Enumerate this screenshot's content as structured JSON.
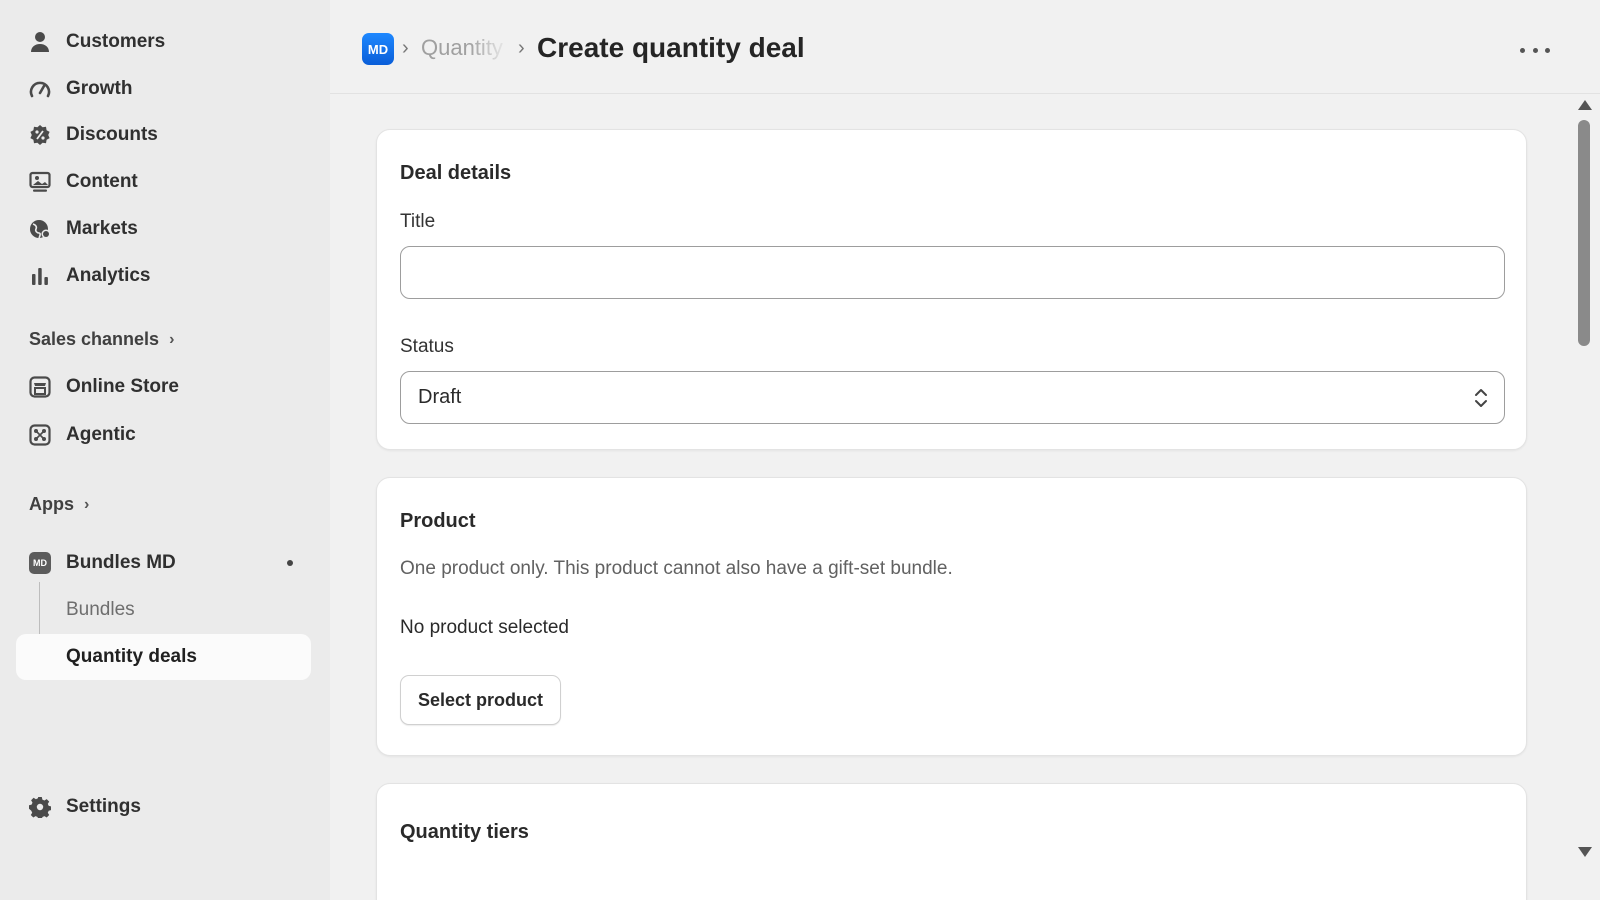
{
  "sidebar": {
    "items": [
      {
        "label": "Customers",
        "icon": "person-icon"
      },
      {
        "label": "Growth",
        "icon": "gauge-icon"
      },
      {
        "label": "Discounts",
        "icon": "discount-badge-icon"
      },
      {
        "label": "Content",
        "icon": "content-icon"
      },
      {
        "label": "Markets",
        "icon": "globe-icon"
      },
      {
        "label": "Analytics",
        "icon": "bar-chart-icon"
      }
    ],
    "sales_channels": {
      "heading": "Sales channels",
      "items": [
        {
          "label": "Online Store",
          "icon": "store-icon"
        },
        {
          "label": "Agentic",
          "icon": "agentic-icon"
        }
      ]
    },
    "apps": {
      "heading": "Apps",
      "app": {
        "label": "Bundles MD",
        "badge": "MD"
      },
      "sub_items": [
        {
          "label": "Bundles"
        },
        {
          "label": "Quantity deals",
          "active": true
        }
      ]
    },
    "settings": {
      "label": "Settings",
      "icon": "gear-icon"
    }
  },
  "header": {
    "logo": "MD",
    "breadcrumb": {
      "parent": "Quantity deals",
      "separator": "›"
    },
    "title": "Create quantity deal"
  },
  "deal_details": {
    "title": "Deal details",
    "title_field": {
      "label": "Title",
      "value": "",
      "placeholder": ""
    },
    "status_field": {
      "label": "Status",
      "value": "Draft"
    }
  },
  "product": {
    "title": "Product",
    "help": "One product only. This product cannot also have a gift-set bundle.",
    "empty_state": "No product selected",
    "button": "Select product"
  },
  "quantity_tiers": {
    "title": "Quantity tiers"
  },
  "colors": {
    "logo_blue": "#1a73f0",
    "sidebar_bg": "#ebebeb",
    "page_bg": "#f1f1f1",
    "card_bg": "#ffffff"
  }
}
